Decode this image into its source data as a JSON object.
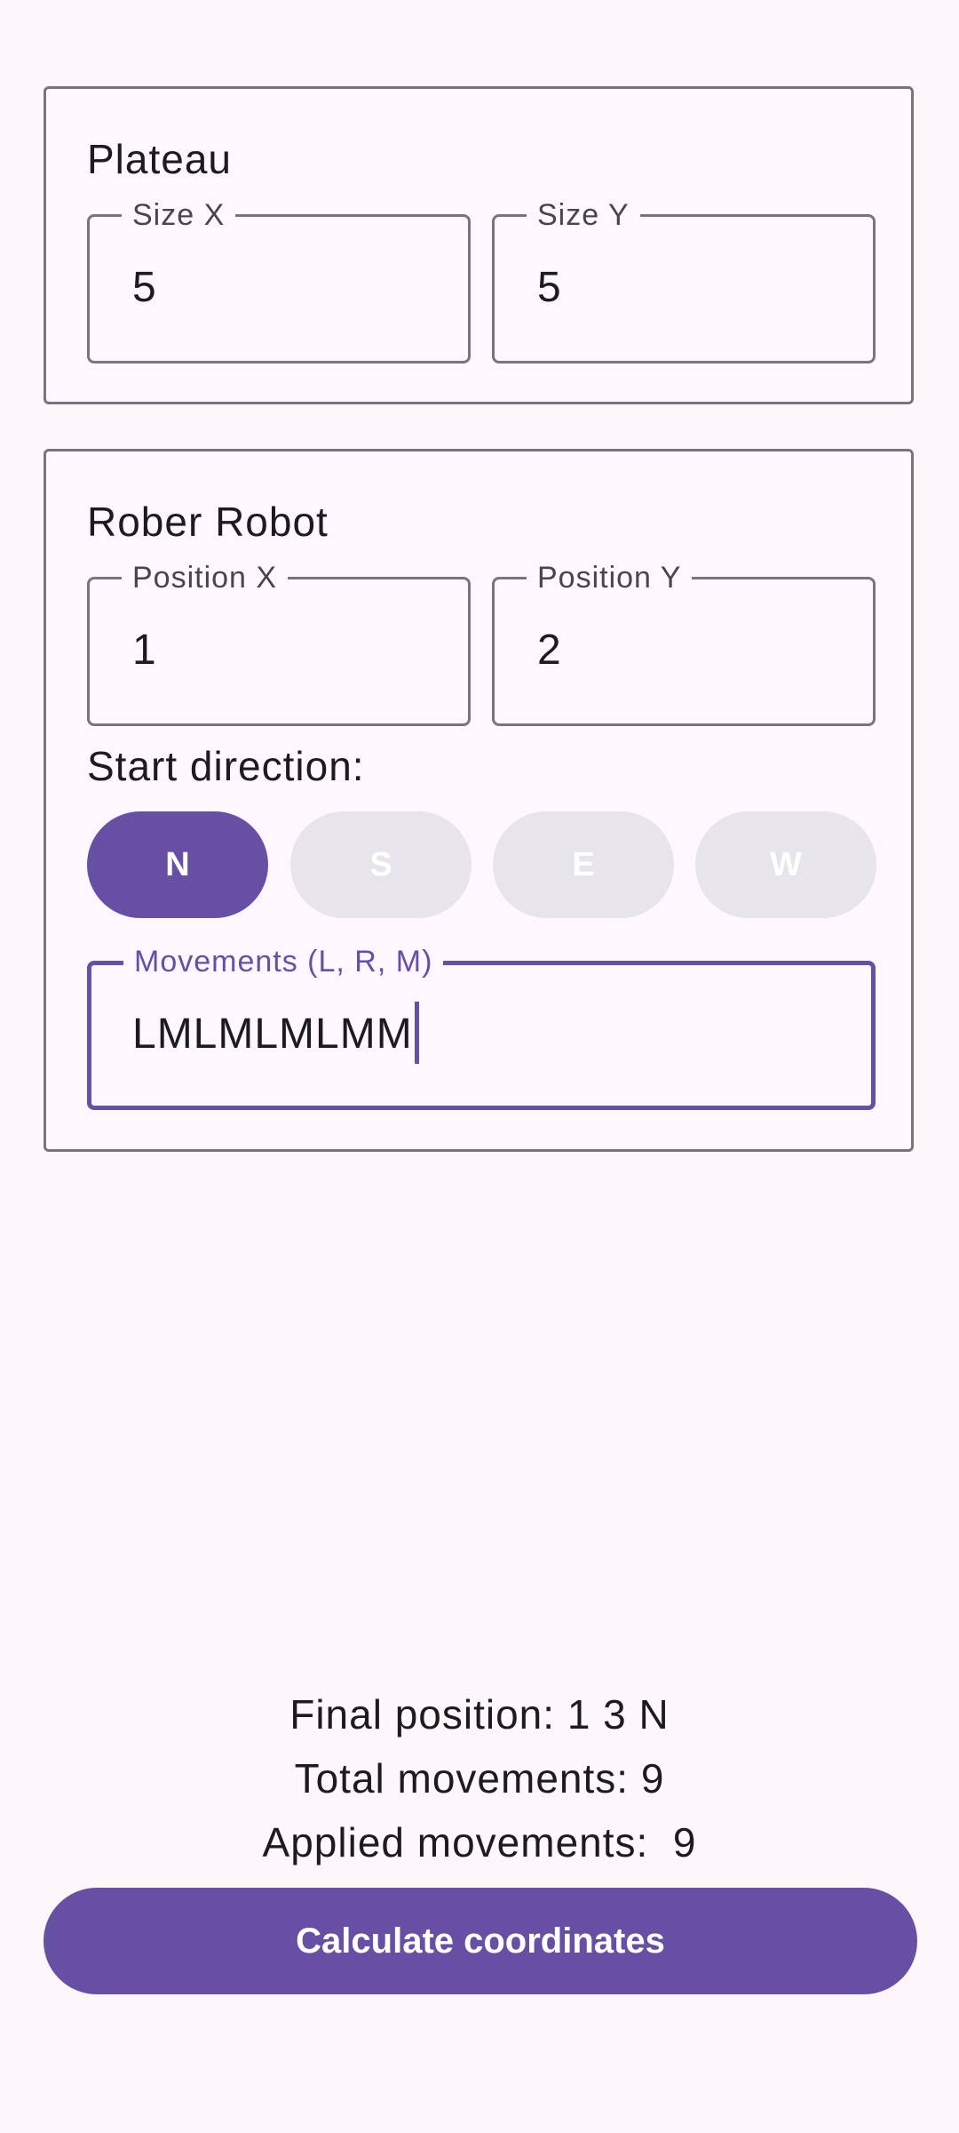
{
  "plateau": {
    "title": "Plateau",
    "size_x": {
      "label": "Size X",
      "value": "5"
    },
    "size_y": {
      "label": "Size Y",
      "value": "5"
    }
  },
  "robot": {
    "title": "Rober Robot",
    "position_x": {
      "label": "Position X",
      "value": "1"
    },
    "position_y": {
      "label": "Position Y",
      "value": "2"
    },
    "direction_label": "Start direction:",
    "directions": [
      {
        "label": "N",
        "selected": true
      },
      {
        "label": "S",
        "selected": false
      },
      {
        "label": "E",
        "selected": false
      },
      {
        "label": "W",
        "selected": false
      }
    ],
    "movements": {
      "label": "Movements (L, R, M)",
      "value": "LMLMLMLMM"
    }
  },
  "results": {
    "final_position": "Final position: 1 3 N",
    "total_movements": "Total movements: 9",
    "applied_movements": "Applied movements:  9"
  },
  "calculate_button_label": "Calculate coordinates",
  "colors": {
    "primary": "#6750A4",
    "background": "#FDF7FC",
    "outline": "#79747E",
    "unselected_chip": "#E8E4EB"
  }
}
